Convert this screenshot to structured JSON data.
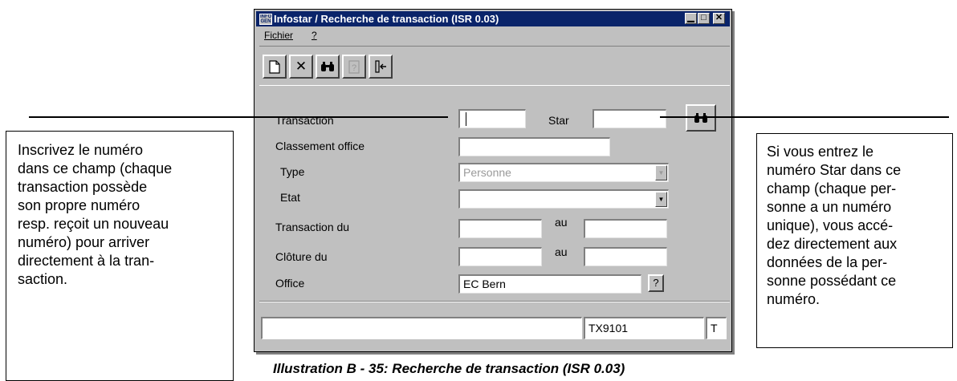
{
  "window": {
    "title": "Infostar / Recherche de transaction (ISR 0.03)",
    "app_icon_text": "INFO GEN",
    "controls": {
      "minimize": "▁",
      "maximize": "□",
      "close": "✕"
    }
  },
  "menu": [
    {
      "label": "Fichier"
    },
    {
      "label": "?"
    }
  ],
  "toolbar": [
    {
      "name": "new",
      "icon": "new-document-icon",
      "glyph": "🗋",
      "enabled": true
    },
    {
      "name": "delete",
      "icon": "delete-x-icon",
      "glyph": "✕",
      "enabled": true
    },
    {
      "name": "search",
      "icon": "binoculars-icon",
      "glyph": "🔭",
      "enabled": true
    },
    {
      "name": "help",
      "icon": "help-page-icon",
      "glyph": "?",
      "enabled": false
    },
    {
      "name": "exit",
      "icon": "exit-door-icon",
      "glyph": "⇦",
      "enabled": true
    }
  ],
  "form": {
    "transaction": {
      "label": "Transaction",
      "value": ""
    },
    "star": {
      "label": "Star",
      "value": ""
    },
    "classement": {
      "label": "Classement office",
      "value": ""
    },
    "type": {
      "label": "Type",
      "value": "Personne",
      "enabled": false
    },
    "etat": {
      "label": "Etat",
      "value": ""
    },
    "transaction_du": {
      "label": "Transaction du",
      "from": "",
      "to_label": "au",
      "to": ""
    },
    "cloture_du": {
      "label": "Clôture du",
      "from": "",
      "to_label": "au",
      "to": ""
    },
    "office": {
      "label": "Office",
      "value": "EC Bern",
      "lookup": "?"
    }
  },
  "status_bar": {
    "message": "",
    "code": "TX9101",
    "mode": "T"
  },
  "callouts": {
    "left": [
      "Inscrivez le numéro",
      "dans ce champ (chaque",
      "transaction possède",
      "son propre numéro",
      "resp. reçoit un nouveau",
      "numéro) pour arriver",
      "directement à la tran-",
      "saction."
    ],
    "right": [
      "Si vous entrez le",
      "numéro Star dans ce",
      "champ (chaque per-",
      "sonne a un numéro",
      "unique), vous accé-",
      "dez directement aux",
      "données de la per-",
      "sonne possédant ce",
      "numéro."
    ]
  },
  "caption": "Illustration B - 35: Recherche de transaction (ISR 0.03)"
}
